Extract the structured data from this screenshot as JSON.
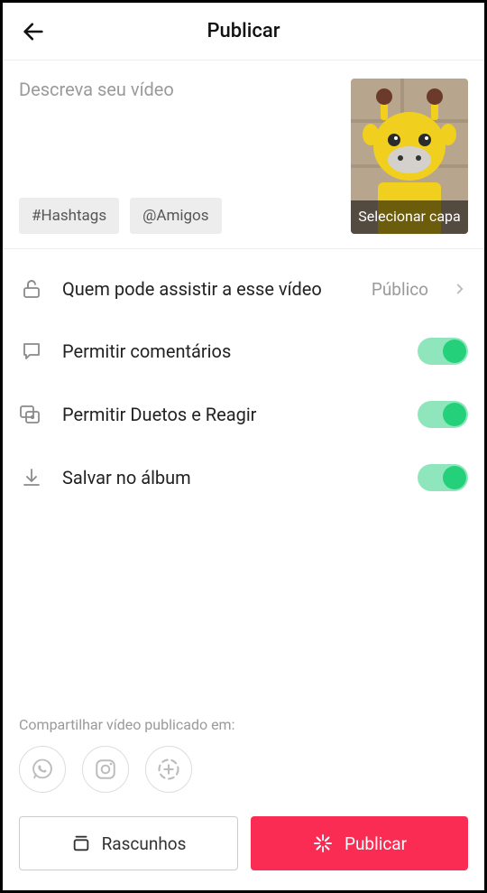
{
  "header": {
    "title": "Publicar"
  },
  "caption": {
    "placeholder": "Descreva seu vídeo",
    "hashtags_label": "#Hashtags",
    "mentions_label": "@Amigos",
    "cover_label": "Selecionar capa"
  },
  "settings": {
    "privacy": {
      "label": "Quem pode assistir a esse vídeo",
      "value": "Público"
    },
    "comments": {
      "label": "Permitir comentários",
      "enabled": true
    },
    "duets": {
      "label": "Permitir Duetos e Reagir",
      "enabled": true
    },
    "save_album": {
      "label": "Salvar no álbum",
      "enabled": true
    }
  },
  "share": {
    "label": "Compartilhar vídeo publicado em:"
  },
  "buttons": {
    "drafts": "Rascunhos",
    "publish": "Publicar"
  }
}
